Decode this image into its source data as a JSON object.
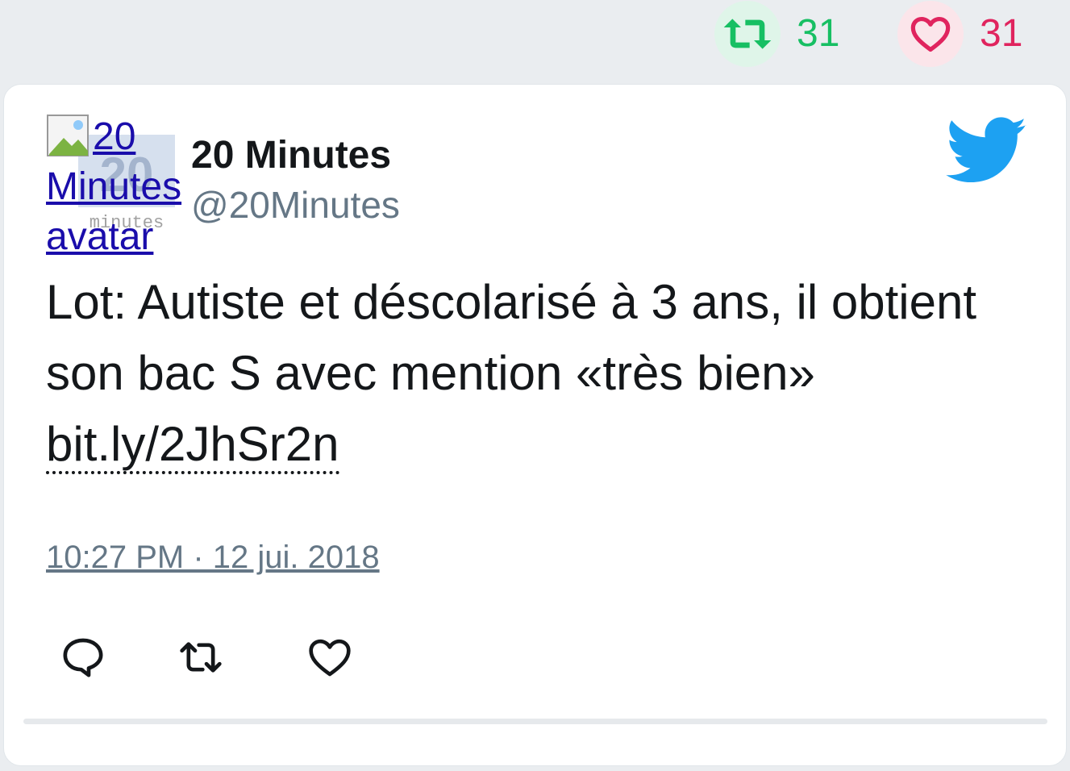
{
  "stats": {
    "retweet_count": "31",
    "like_count": "31",
    "retweet_color": "#17bf63",
    "like_color": "#e0245e"
  },
  "tweet": {
    "avatar_alt_line1": "20",
    "avatar_alt_line2": "Minutes",
    "avatar_alt_line3": "avatar",
    "author_name": "20 Minutes",
    "author_handle": "@20Minutes",
    "text_before_link": "Lot: Autiste et déscolarisé à 3 ans, il obtient son bac S avec mention «très bien» ",
    "link_text": "bit.ly/2JhSr2n",
    "timestamp": "10:27 PM · 12 jui. 2018",
    "brand_icon": "twitter-bird-icon",
    "brand_color": "#1da1f2"
  },
  "actions": {
    "icons": [
      "reply-icon",
      "retweet-icon",
      "like-icon"
    ]
  }
}
